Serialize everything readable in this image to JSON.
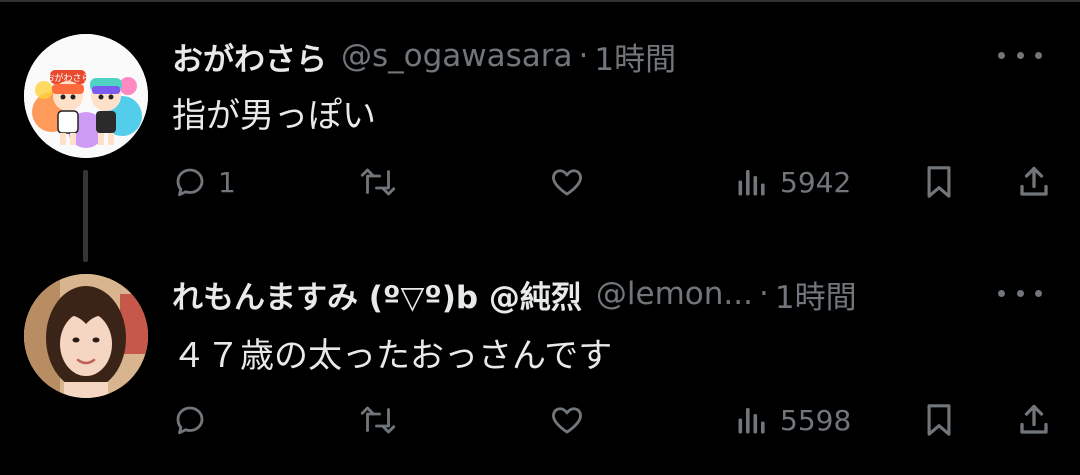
{
  "tweets": [
    {
      "name": "おがわさら",
      "handle": "@s_ogawasara",
      "separator": "·",
      "time": "1時間",
      "text": "指が男っぽい",
      "reply_count": "1",
      "views": "5942",
      "avatar_text": "おがわさら"
    },
    {
      "name": "れもんますみ (º▽º)b @純烈",
      "handle": "@lemon...",
      "separator": "·",
      "time": "1時間",
      "text": "４７歳の太ったおっさんです",
      "reply_count": "",
      "views": "5598"
    }
  ],
  "icons": {
    "reply": "reply-icon",
    "retweet": "retweet-icon",
    "like": "heart-icon",
    "views": "views-chart-icon",
    "bookmark": "bookmark-icon",
    "share": "share-icon",
    "more": "more-icon"
  },
  "colors": {
    "background": "#000000",
    "text_primary": "#e7e9ea",
    "text_secondary": "#71767b",
    "thread_line": "#333639"
  }
}
